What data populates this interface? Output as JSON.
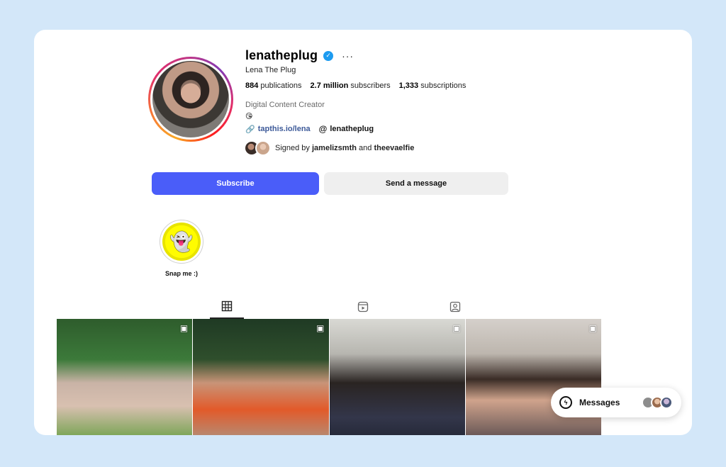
{
  "profile": {
    "username": "lenatheplug",
    "verified_mark": "✓",
    "more_label": "···",
    "display_name": "Lena The Plug",
    "stats": {
      "publications_count": "884",
      "publications_label": "publications",
      "subscribers_count": "2.7 million",
      "subscribers_label": "subscribers",
      "subscriptions_count": "1,333",
      "subscriptions_label": "subscriptions"
    },
    "bio": "Digital Content Creator",
    "emoji": "😘",
    "link_text": "tapthis.io/lena",
    "threads_handle": "lenatheplug",
    "signed_prefix": "Signed by",
    "signed_user1": "jamelizsmth",
    "signed_and": "and",
    "signed_user2": "theevaelfie"
  },
  "buttons": {
    "subscribe_label": "Subscribe",
    "message_label": "Send a message"
  },
  "highlight": {
    "label": "Snap me :)",
    "icon": "snapchat-ghost-icon"
  },
  "tabs": [
    {
      "icon": "grid-icon",
      "active": true
    },
    {
      "icon": "reels-icon",
      "active": false
    },
    {
      "icon": "tagged-icon",
      "active": false
    }
  ],
  "posts": [
    {
      "type": "reel"
    },
    {
      "type": "reel"
    },
    {
      "type": "reel"
    },
    {
      "type": "reel"
    }
  ],
  "messages": {
    "label": "Messages"
  },
  "colors": {
    "page_bg": "#d3e7f9",
    "primary_button": "#4a5df9",
    "secondary_button": "#efefef",
    "verified": "#1d9bf0",
    "link": "#3d5a99"
  }
}
